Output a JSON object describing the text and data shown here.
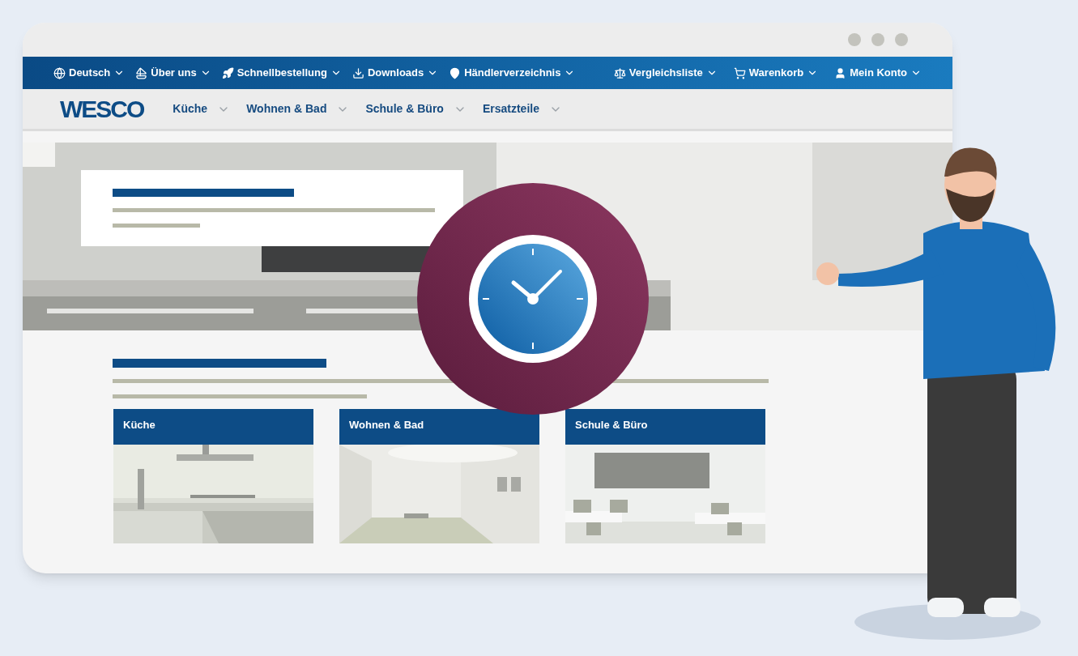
{
  "browser": {
    "top_links": [
      {
        "label": "Deutsch",
        "kind": "globe"
      },
      {
        "label": "Über uns",
        "kind": "sail"
      },
      {
        "label": "Schnellbestellung",
        "kind": "rocket"
      },
      {
        "label": "Downloads",
        "kind": "download"
      },
      {
        "label": "Händlerverzeichnis",
        "kind": "pin"
      }
    ],
    "right_links": [
      {
        "label": "Vergleichsliste",
        "kind": "scale"
      },
      {
        "label": "Warenkorb",
        "kind": "cart"
      },
      {
        "label": "Mein Konto",
        "kind": "user"
      }
    ],
    "logo": "WESCO",
    "menu": [
      "Küche",
      "Wohnen & Bad",
      "Schule & Büro",
      "Ersatzteile"
    ],
    "categories": [
      {
        "title": "Küche",
        "kind": "kitchen"
      },
      {
        "title": "Wohnen & Bad",
        "kind": "bath"
      },
      {
        "title": "Schule & Büro",
        "kind": "office"
      }
    ]
  }
}
